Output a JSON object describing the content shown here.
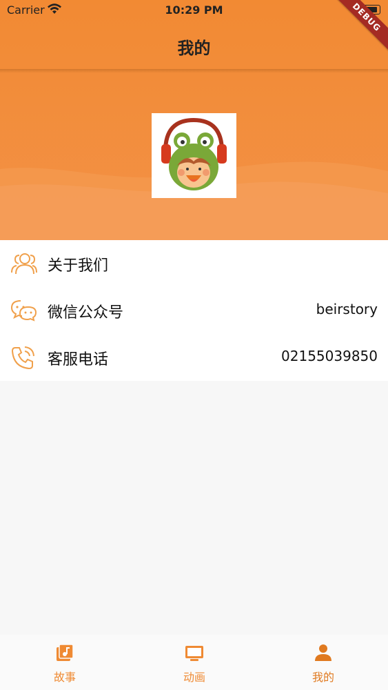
{
  "status_bar": {
    "carrier": "Carrier",
    "time": "10:29 PM"
  },
  "debug_banner": "DEBUG",
  "nav": {
    "title": "我的"
  },
  "menu": [
    {
      "label": "关于我们",
      "value": "",
      "icon": "people-icon"
    },
    {
      "label": "微信公众号",
      "value": "beirstory",
      "icon": "wechat-icon"
    },
    {
      "label": "客服电话",
      "value": "02155039850",
      "icon": "phone-icon"
    }
  ],
  "tabs": [
    {
      "label": "故事",
      "icon": "music-library-icon"
    },
    {
      "label": "动画",
      "icon": "tv-icon"
    },
    {
      "label": "我的",
      "icon": "person-icon",
      "active": true
    }
  ],
  "colors": {
    "accent": "#f28a33",
    "icon": "#f0a04b"
  }
}
